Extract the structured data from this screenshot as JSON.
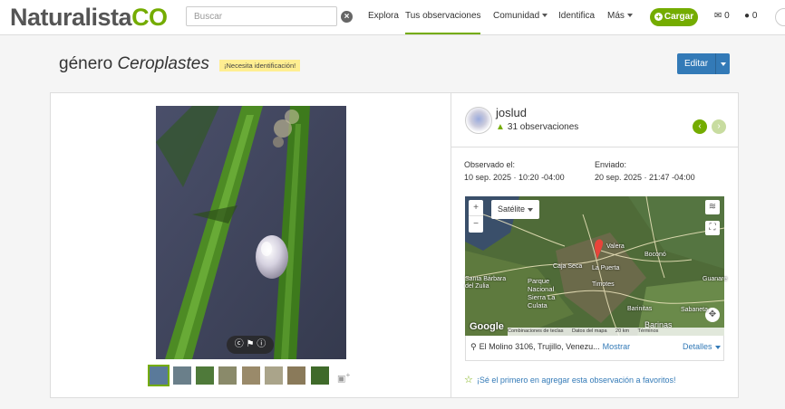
{
  "header": {
    "logo_part1": "Naturalista",
    "logo_part2": "CO",
    "search_placeholder": "Buscar",
    "nav": [
      {
        "label": "Explora"
      },
      {
        "label": "Tus observaciones"
      },
      {
        "label": "Comunidad"
      },
      {
        "label": "Identifica"
      },
      {
        "label": "Más"
      }
    ],
    "upload_label": "Cargar",
    "messages_count": "0",
    "notifications_count": "0",
    "accent_color": "#74ac00"
  },
  "observation": {
    "title_prefix": "género",
    "title_taxon": "Ceroplastes",
    "badge": "¡Necesita identificación!",
    "edit_label": "Editar"
  },
  "user": {
    "name": "joslud",
    "observations": "31 observaciones"
  },
  "meta": {
    "observed_label": "Observado el:",
    "observed_value": "10 sep. 2025 · 10:20 -04:00",
    "submitted_label": "Enviado:",
    "submitted_value": "20 sep. 2025 · 21:47 -04:00"
  },
  "map": {
    "layer_button": "Satélite",
    "zoom_in": "+",
    "zoom_out": "−",
    "labels": {
      "valera": "Valera",
      "bocono": "Boconó",
      "caja_seca": "Caja Seca",
      "la_puerta": "La Puerta",
      "santa_barbara": "Santa Bárbara del Zulia",
      "parque": "Parque Nacional Sierra La Culata",
      "timotes": "Timotes",
      "guanare": "Guanare",
      "barinitas": "Barinitas",
      "sabaneta": "Sabaneta",
      "barinas": "Barinas"
    },
    "attrib": {
      "google": "Google",
      "shortcuts": "Combinaciones de teclas",
      "data": "Datos del mapa",
      "scale": "20 km",
      "terms": "Términos"
    },
    "location": "El Molino 3106, Trujillo, Venezu...",
    "show_more": "Mostrar",
    "details": "Detalles"
  },
  "favorite": "¡Sé el primero en agregar esta observación a favoritos!"
}
